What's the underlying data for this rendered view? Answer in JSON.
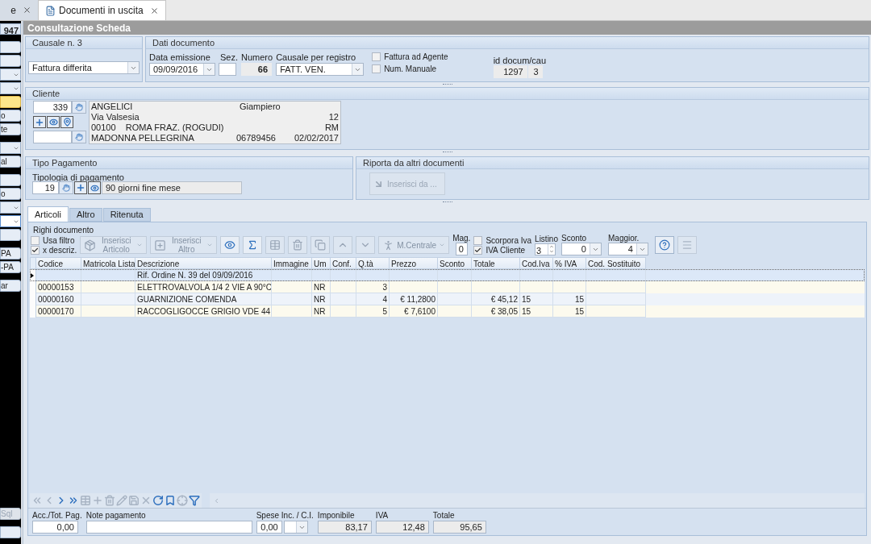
{
  "tabs": [
    {
      "label": "e",
      "selected": false
    },
    {
      "label": "Documenti in uscita",
      "selected": true
    }
  ],
  "sidebar": {
    "groups": [
      [
        {
          "kind": "field",
          "label": "947"
        }
      ],
      [
        {
          "kind": "button",
          "selected": false,
          "disabled": false
        },
        {
          "kind": "button",
          "selected": false,
          "disabled": false
        },
        {
          "kind": "dropdown",
          "focused": false
        },
        {
          "kind": "dropdown",
          "focused": false
        },
        {
          "kind": "button",
          "selected": true,
          "disabled": false
        },
        {
          "kind": "button",
          "label": "o",
          "selected": false,
          "disabled": false
        },
        {
          "kind": "button",
          "label": "te",
          "selected": false,
          "disabled": false
        }
      ],
      [
        {
          "kind": "dropdown",
          "focused": false
        },
        {
          "kind": "button",
          "label": "al",
          "selected": false,
          "disabled": false
        }
      ],
      [
        {
          "kind": "button",
          "selected": false,
          "disabled": false
        },
        {
          "kind": "button",
          "label": "o",
          "selected": false,
          "disabled": false
        },
        {
          "kind": "dropdown",
          "focused": false
        },
        {
          "kind": "dropdown",
          "focused": true
        },
        {
          "kind": "button",
          "selected": false,
          "disabled": false
        }
      ],
      [
        {
          "kind": "button",
          "label": "PA",
          "selected": false,
          "disabled": false
        },
        {
          "kind": "button",
          "label": "-PA",
          "selected": false,
          "disabled": false
        }
      ],
      [
        {
          "kind": "button",
          "label": "ar",
          "selected": false,
          "disabled": false
        }
      ]
    ],
    "bottom": [
      {
        "kind": "button",
        "label": "Sql",
        "selected": false,
        "disabled": true
      },
      {
        "kind": "button",
        "selected": false,
        "disabled": false
      }
    ]
  },
  "title": "Consultazione Scheda",
  "causale": {
    "title": "Causale n. 3",
    "value": "Fattura differita"
  },
  "dati_documento": {
    "title": "Dati documento",
    "data_label": "Data emissione",
    "data": "09/09/2016",
    "sez_label": "Sez.",
    "numero_label": "Numero",
    "numero": "66",
    "registro_label": "Causale per registro",
    "registro": "FATT. VEN.",
    "checks": [
      {
        "label": "Fattura ad Agente",
        "checked": false
      },
      {
        "label": "Num. Manuale",
        "checked": false
      }
    ],
    "id_label": "id docum/cau",
    "id": "1297",
    "cau": "3"
  },
  "cliente": {
    "title": "Cliente",
    "code": "339",
    "lines": [
      [
        "ANGELICI",
        "Giampiero"
      ],
      [
        "Via Valsesia",
        "12"
      ],
      [
        "00100    ROMA FRAZ. (ROGUDI)",
        "RM"
      ],
      [
        "MADONNA PELLEGRINA",
        "06789456",
        "02/02/2017"
      ]
    ]
  },
  "tipo_pagamento": {
    "title": "Tipo Pagamento",
    "label": "Tipologia di pagamento",
    "code": "19",
    "value": "90 giorni fine mese"
  },
  "riporta": {
    "title": "Riporta da altri documenti",
    "button": "Inserisci da ..."
  },
  "doc_tabs": [
    {
      "label": "Articoli",
      "selected": true
    },
    {
      "label": "Altro",
      "selected": false
    },
    {
      "label": "Ritenuta",
      "selected": false
    }
  ],
  "righi": {
    "title": "Righi documento",
    "filters": [
      {
        "label": "Usa filtro",
        "checked": false
      },
      {
        "label": "x descriz.",
        "checked": true
      }
    ],
    "tools": [
      {
        "kind": "box",
        "label": "Inserisci Articolo",
        "disabled": true,
        "dropdown": true
      },
      {
        "kind": "add",
        "label": "Inserisci Altro",
        "disabled": true,
        "dropdown": true
      },
      {
        "kind": "eye",
        "disabled": false
      },
      {
        "kind": "sigma",
        "disabled": false
      },
      {
        "kind": "grid",
        "disabled": true
      },
      {
        "kind": "trash",
        "disabled": true
      },
      {
        "kind": "copy",
        "disabled": true
      },
      {
        "kind": "up",
        "disabled": true
      },
      {
        "kind": "down",
        "disabled": true
      },
      {
        "kind": "person",
        "label": "M.Centrale",
        "disabled": true,
        "dropdown": true
      }
    ],
    "mag_label": "Mag.",
    "mag": "0",
    "iva_checks": [
      {
        "label": "Scorpora Iva",
        "checked": false
      },
      {
        "label": "IVA Cliente",
        "checked": true
      }
    ],
    "listino_label": "Listino",
    "listino": "3",
    "sconto_label": "Sconto",
    "sconto": "0",
    "maggior_label": "Maggior.",
    "maggior": "4"
  },
  "table": {
    "columns": [
      {
        "label": "Codice"
      },
      {
        "label": "Matricola Lista"
      },
      {
        "label": "Descrizione"
      },
      {
        "label": "Immagine"
      },
      {
        "label": "Um"
      },
      {
        "label": "Conf."
      },
      {
        "label": "Q.tà"
      },
      {
        "label": "Prezzo"
      },
      {
        "label": "Sconto"
      },
      {
        "label": "Totale"
      },
      {
        "label": "Cod.Iva"
      },
      {
        "label": "% IVA"
      },
      {
        "label": "Cod. Sostituito"
      }
    ],
    "rows": [
      {
        "selected": true,
        "cells": [
          "",
          "",
          "Rif. Ordine N. 39 del 09/09/2016",
          "",
          "",
          "",
          "",
          "",
          "",
          "",
          "",
          "",
          ""
        ]
      },
      {
        "selected": false,
        "cells": [
          "00000153",
          "",
          "ELETTROVALVOLA 1/4 2 VIE A 90°C",
          "",
          "NR",
          "",
          "3",
          "",
          "",
          "",
          "",
          "",
          ""
        ]
      },
      {
        "selected": false,
        "cells": [
          "00000160",
          "",
          "GUARNIZIONE COMENDA",
          "",
          "NR",
          "",
          "4",
          "€ 11,2800",
          "",
          "€ 45,12",
          "15",
          "15",
          ""
        ]
      },
      {
        "selected": false,
        "cells": [
          "00000170",
          "",
          "RACCOGLIGOCCE GRIGIO VDE 44",
          "",
          "NR",
          "",
          "5",
          "€ 7,6100",
          "",
          "€ 38,05",
          "15",
          "15",
          ""
        ]
      }
    ]
  },
  "navigator": [
    {
      "kind": "first",
      "disabled": true
    },
    {
      "kind": "prev",
      "disabled": true
    },
    {
      "kind": "next",
      "disabled": false
    },
    {
      "kind": "last",
      "disabled": false
    },
    {
      "kind": "grid",
      "disabled": true
    },
    {
      "kind": "plus",
      "disabled": true
    },
    {
      "kind": "trash",
      "disabled": true
    },
    {
      "kind": "edit",
      "disabled": true
    },
    {
      "kind": "save",
      "disabled": true
    },
    {
      "kind": "cancel",
      "disabled": true
    },
    {
      "kind": "refresh",
      "disabled": false
    },
    {
      "kind": "bookmark",
      "disabled": false
    },
    {
      "kind": "target",
      "disabled": true
    },
    {
      "kind": "filter",
      "disabled": false
    }
  ],
  "footer": {
    "acc_label": "Acc./Tot. Pag.",
    "acc": "0,00",
    "note_label": "Note pagamento",
    "spese_label": "Spese Inc. / C.I.",
    "spese": "0,00",
    "imponibile_label": "Imponibile",
    "imponibile": "83,17",
    "iva_label": "IVA",
    "iva": "12,48",
    "totale_label": "Totale",
    "totale": "95,65"
  }
}
